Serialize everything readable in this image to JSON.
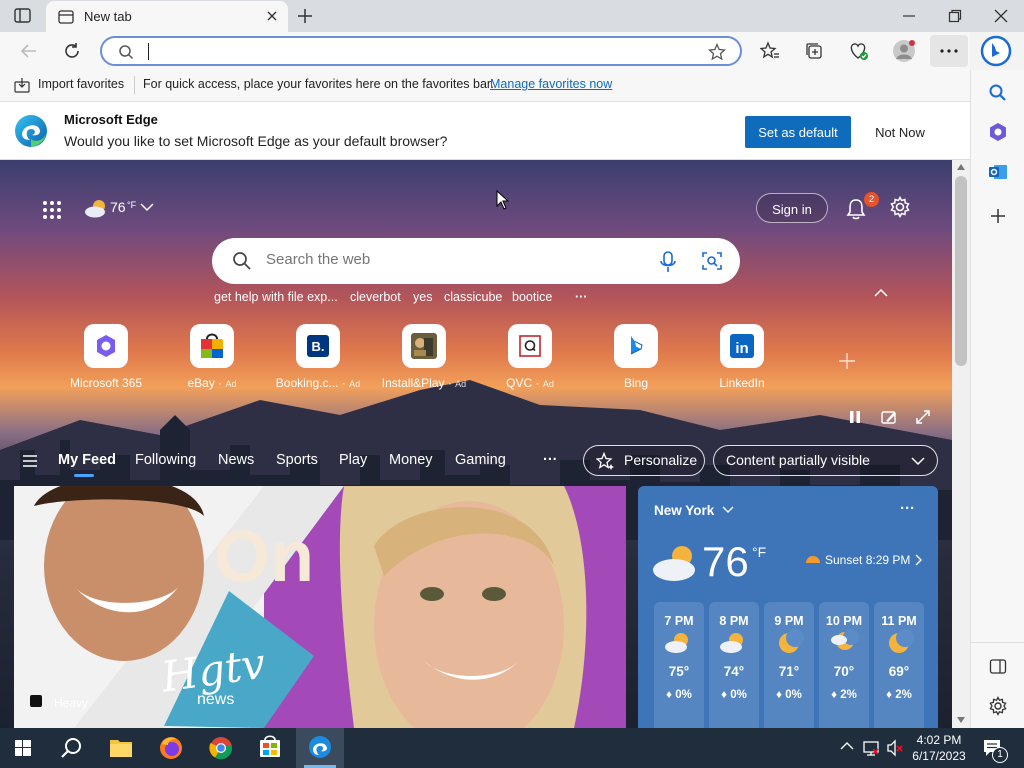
{
  "tab": {
    "title": "New tab"
  },
  "address": {
    "value": "",
    "placeholder": ""
  },
  "favorites_bar": {
    "import_label": "Import favorites",
    "message": "For quick access, place your favorites here on the favorites bar.",
    "manage_link": "Manage favorites now"
  },
  "notification": {
    "title": "Microsoft Edge",
    "message": "Would you like to set Microsoft Edge as your default browser?",
    "primary_button": "Set as default",
    "secondary_button": "Not Now"
  },
  "newtab": {
    "weather_temp": "76",
    "weather_unit": "°F",
    "sign_in": "Sign in",
    "notification_count": "2",
    "search_placeholder": "Search the web",
    "suggestions": [
      "get help with file exp...",
      "cleverbot",
      "yes",
      "classicube",
      "bootice",
      "···"
    ],
    "quick_links": [
      {
        "label": "Microsoft 365",
        "ad": ""
      },
      {
        "label": "eBay",
        "ad": "Ad"
      },
      {
        "label": "Booking.c...",
        "ad": "Ad"
      },
      {
        "label": "Install&Play",
        "ad": "Ad"
      },
      {
        "label": "QVC",
        "ad": "Ad"
      },
      {
        "label": "Bing",
        "ad": ""
      },
      {
        "label": "LinkedIn",
        "ad": ""
      }
    ],
    "feed_tabs": [
      "My Feed",
      "Following",
      "News",
      "Sports",
      "Play",
      "Money",
      "Gaming",
      "···"
    ],
    "personalize": "Personalize",
    "content_visibility": "Content partially visible",
    "hero_source": "Heavy",
    "hero_logo": "Hgtv",
    "hero_logo_sub": "news",
    "hero_text": "On"
  },
  "weather_card": {
    "location": "New York",
    "temp": "76",
    "unit": "°F",
    "sunset": "Sunset 8:29 PM",
    "hours": [
      {
        "time": "7 PM",
        "temp": "75°",
        "precip": "0%"
      },
      {
        "time": "8 PM",
        "temp": "74°",
        "precip": "0%"
      },
      {
        "time": "9 PM",
        "temp": "71°",
        "precip": "0%"
      },
      {
        "time": "10 PM",
        "temp": "70°",
        "precip": "2%"
      },
      {
        "time": "11 PM",
        "temp": "69°",
        "precip": "2%"
      }
    ]
  },
  "taskbar": {
    "time": "4:02 PM",
    "date": "6/17/2023",
    "notification_count": "1"
  },
  "colors": {
    "accent": "#0f6cbd",
    "link": "#0f6cbd",
    "taskbar": "#1f2d3d",
    "weather_card": "#3d75b8"
  }
}
